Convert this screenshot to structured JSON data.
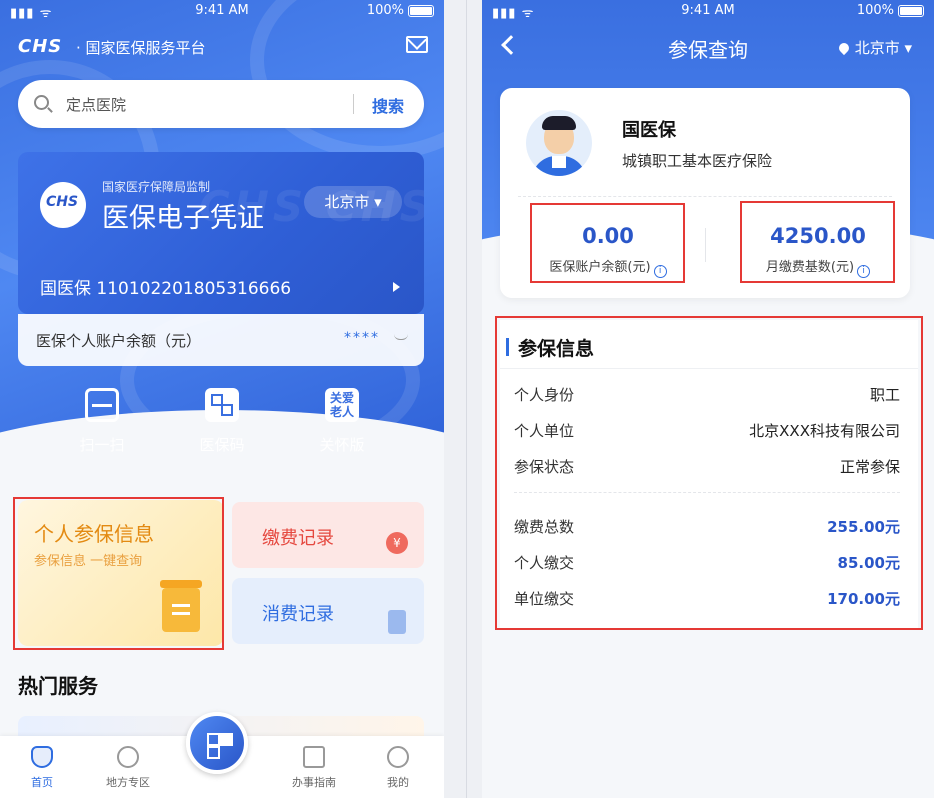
{
  "left": {
    "status": {
      "time": "9:41 AM",
      "signal": "▮▮▮ ᯤ",
      "battery": "100%"
    },
    "header": {
      "logo": "CHS",
      "platform": "· 国家医保服务平台"
    },
    "search": {
      "placeholder": "定点医院",
      "button": "搜索"
    },
    "card": {
      "badge": "CHS",
      "watermark": "CHS CHS",
      "supervisor": "国家医疗保障局监制",
      "title": "医保电子凭证",
      "city": "北京市 ▾",
      "holder": "国医保  110102201805316666"
    },
    "balance": {
      "label": "医保个人账户余额（元）",
      "masked": "****"
    },
    "quick_actions": [
      {
        "label": "扫一扫",
        "icon": "scan-icon"
      },
      {
        "label": "医保码",
        "icon": "qrcode-icon"
      },
      {
        "label": "关怀版",
        "icon": "care-icon",
        "glyph": "关爱\n老人"
      }
    ],
    "tiles": {
      "insurance": {
        "title": "个人参保信息",
        "subtitle": "参保信息 一键查询"
      },
      "payment": {
        "title": "缴费记录",
        "icon_glyph": "¥"
      },
      "consumption": {
        "title": "消费记录"
      }
    },
    "hot": {
      "title": "热门服务"
    },
    "tabbar": [
      {
        "label": "首页",
        "active": true
      },
      {
        "label": "地方专区",
        "active": false
      },
      {
        "label": "办事指南",
        "active": false
      },
      {
        "label": "我的",
        "active": false
      }
    ]
  },
  "right": {
    "status": {
      "time": "9:41 AM",
      "signal": "▮▮▮ ᯤ",
      "battery": "100%"
    },
    "nav": {
      "title": "参保查询",
      "location": "北京市 ▾"
    },
    "profile": {
      "name": "国医保",
      "type": "城镇职工基本医疗保险",
      "account_balance": {
        "value": "0.00",
        "label": "医保账户余额(元)"
      },
      "monthly_base": {
        "value": "4250.00",
        "label": "月缴费基数(元)"
      }
    },
    "info": {
      "heading": "参保信息",
      "rows": [
        {
          "key": "个人身份",
          "value": "职工"
        },
        {
          "key": "个人单位",
          "value": "北京XXX科技有限公司"
        },
        {
          "key": "参保状态",
          "value": "正常参保"
        },
        {
          "key": "缴费总数",
          "value": "255.00元"
        },
        {
          "key": "个人缴交",
          "value": "85.00元"
        },
        {
          "key": "单位缴交",
          "value": "170.00元"
        }
      ]
    }
  },
  "colors": {
    "primary": "#2f6de0",
    "highlight": "#e53935",
    "orange": "#e38a12",
    "red": "#e5483f"
  }
}
